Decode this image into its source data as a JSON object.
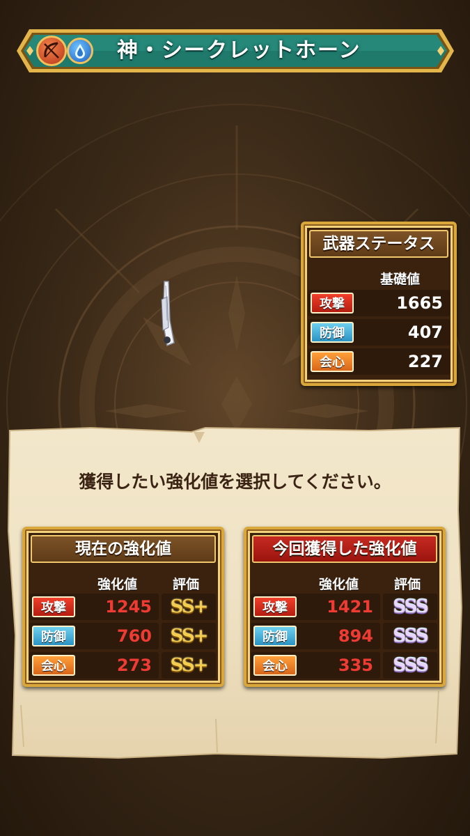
{
  "title": {
    "text": "神・シークレットホーン",
    "element_icons": [
      "bow-icon",
      "water-drop-icon"
    ]
  },
  "weapon_status": {
    "header": "武器ステータス",
    "column_label": "基礎値",
    "rows": [
      {
        "label": "攻撃",
        "value": "1665"
      },
      {
        "label": "防御",
        "value": "407"
      },
      {
        "label": "会心",
        "value": "227"
      }
    ]
  },
  "instruction": "獲得したい強化値を選択してください。",
  "current_panel": {
    "header": "現在の強化値",
    "col_value": "強化値",
    "col_grade": "評価",
    "rows": [
      {
        "label": "攻撃",
        "value": "1245",
        "grade": "SS+"
      },
      {
        "label": "防御",
        "value": "760",
        "grade": "SS+"
      },
      {
        "label": "会心",
        "value": "273",
        "grade": "SS+"
      }
    ]
  },
  "new_panel": {
    "header": "今回獲得した強化値",
    "col_value": "強化値",
    "col_grade": "評価",
    "rows": [
      {
        "label": "攻撃",
        "value": "1421",
        "grade": "SSS"
      },
      {
        "label": "防御",
        "value": "894",
        "grade": "SSS"
      },
      {
        "label": "会心",
        "value": "335",
        "grade": "SSS"
      }
    ]
  },
  "colors": {
    "banner_teal": "#1f7a6c",
    "banner_gold": "#e3b54a",
    "attack_red": "#e03322",
    "defense_blue": "#4fb6dd",
    "critical_orange": "#f08a2a",
    "value_red": "#ee3b33",
    "parchment": "#efe2c4"
  }
}
